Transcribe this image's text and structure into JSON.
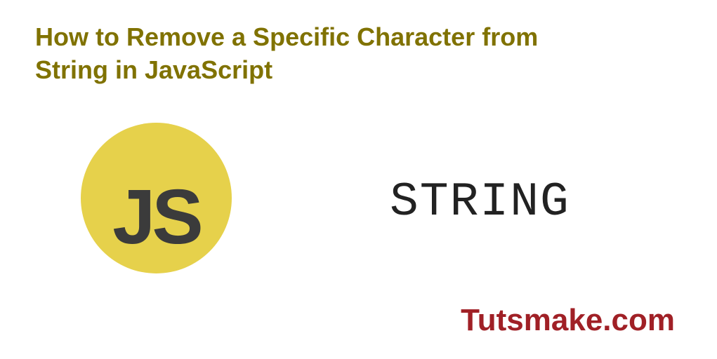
{
  "title": "How to Remove a Specific Character from String in JavaScript",
  "logo": {
    "text": "JS"
  },
  "label": "STRING",
  "brand": "Tutsmake.com",
  "colors": {
    "title": "#807200",
    "logo_bg": "#e6d14b",
    "logo_text": "#3b3b3b",
    "label_text": "#222222",
    "brand_text": "#a02026"
  }
}
